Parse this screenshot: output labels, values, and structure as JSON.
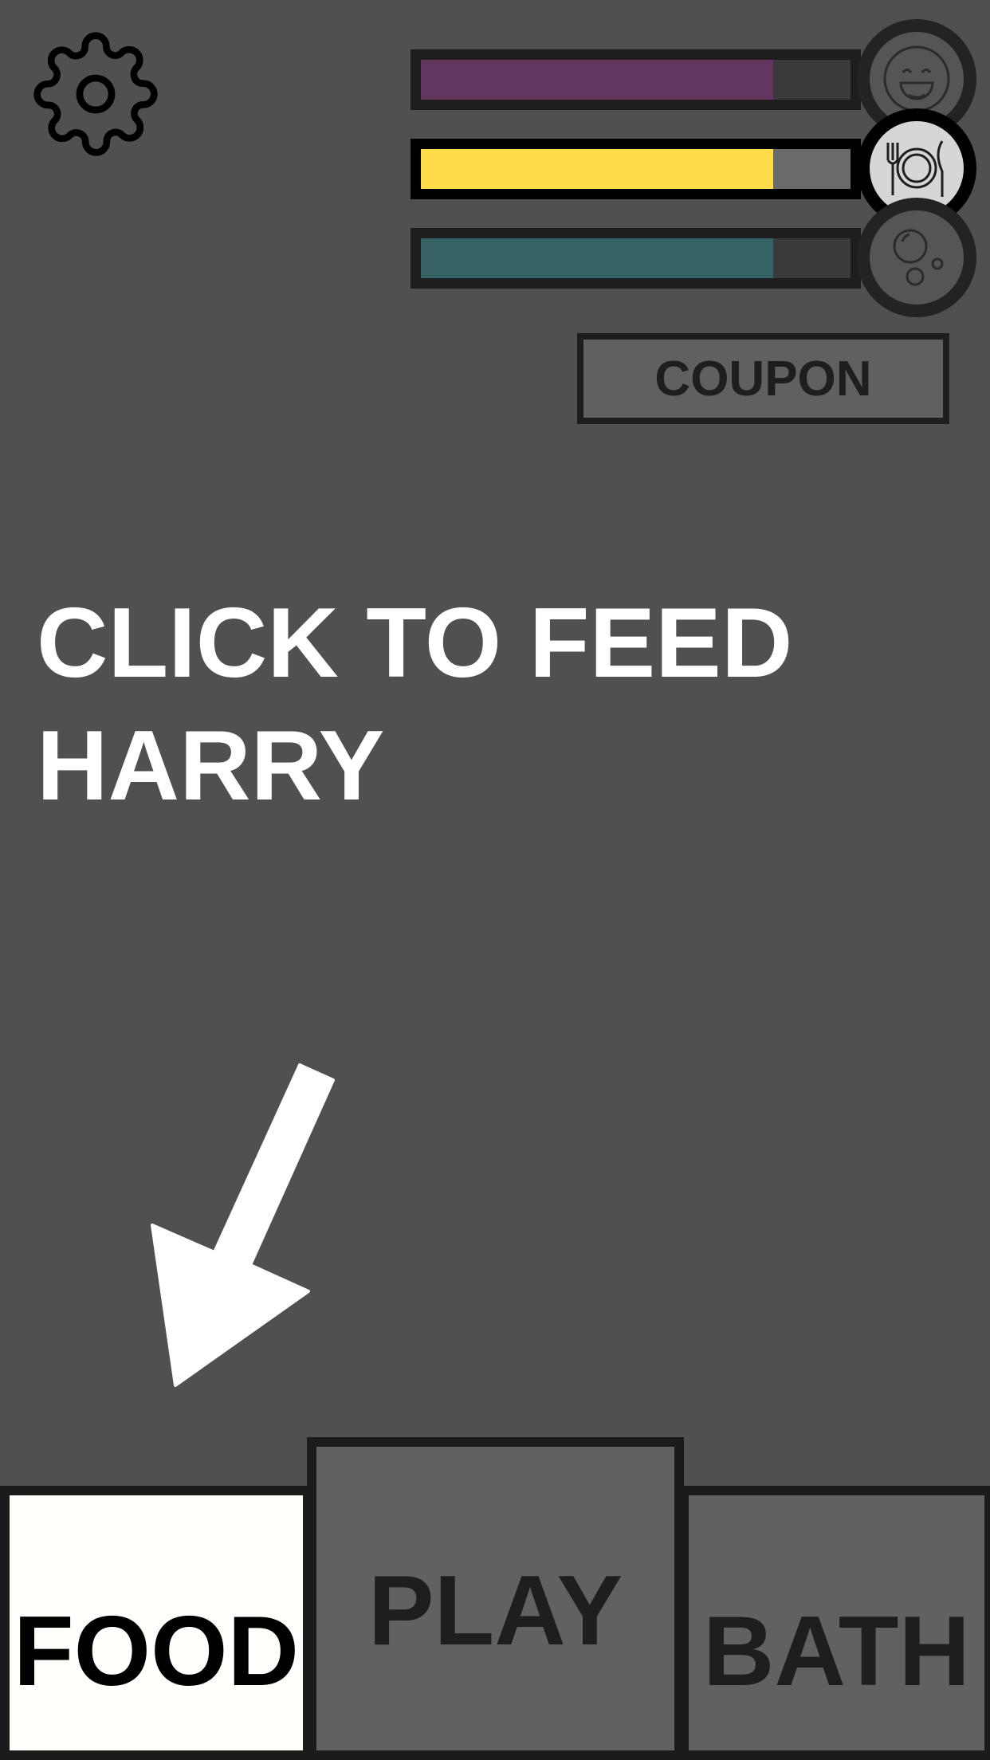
{
  "settings": {
    "icon": "gear-icon"
  },
  "stats": [
    {
      "name": "happiness",
      "icon": "smile-face-icon",
      "level": 0.82,
      "color": "#633660"
    },
    {
      "name": "hunger",
      "icon": "plate-fork-knife-icon",
      "level": 0.82,
      "color": "#FFDD4A"
    },
    {
      "name": "cleanliness",
      "icon": "bubbles-icon",
      "level": 0.82,
      "color": "#356365"
    }
  ],
  "coupon": {
    "label": "COUPON"
  },
  "prompt": {
    "text": "CLICK TO FEED\nHARRY"
  },
  "tabs": {
    "food": {
      "label": "FOOD",
      "active": true
    },
    "play": {
      "label": "PLAY"
    },
    "bath": {
      "label": "BATH"
    }
  }
}
